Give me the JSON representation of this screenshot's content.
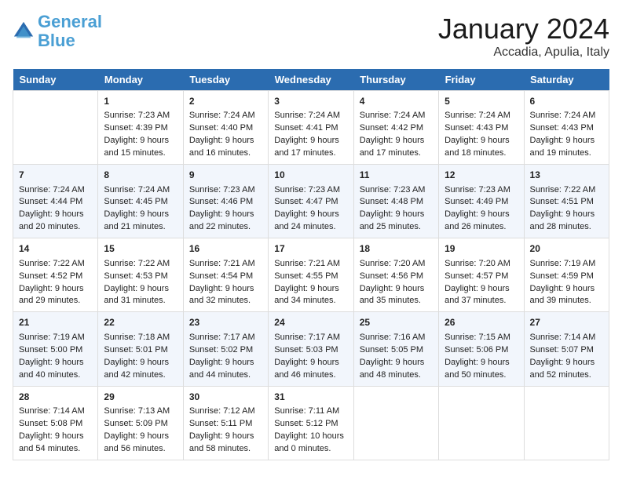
{
  "header": {
    "logo_line1": "General",
    "logo_line2": "Blue",
    "month": "January 2024",
    "location": "Accadia, Apulia, Italy"
  },
  "weekdays": [
    "Sunday",
    "Monday",
    "Tuesday",
    "Wednesday",
    "Thursday",
    "Friday",
    "Saturday"
  ],
  "weeks": [
    [
      {
        "day": "",
        "info": ""
      },
      {
        "day": "1",
        "info": "Sunrise: 7:23 AM\nSunset: 4:39 PM\nDaylight: 9 hours\nand 15 minutes."
      },
      {
        "day": "2",
        "info": "Sunrise: 7:24 AM\nSunset: 4:40 PM\nDaylight: 9 hours\nand 16 minutes."
      },
      {
        "day": "3",
        "info": "Sunrise: 7:24 AM\nSunset: 4:41 PM\nDaylight: 9 hours\nand 17 minutes."
      },
      {
        "day": "4",
        "info": "Sunrise: 7:24 AM\nSunset: 4:42 PM\nDaylight: 9 hours\nand 17 minutes."
      },
      {
        "day": "5",
        "info": "Sunrise: 7:24 AM\nSunset: 4:43 PM\nDaylight: 9 hours\nand 18 minutes."
      },
      {
        "day": "6",
        "info": "Sunrise: 7:24 AM\nSunset: 4:43 PM\nDaylight: 9 hours\nand 19 minutes."
      }
    ],
    [
      {
        "day": "7",
        "info": "Sunrise: 7:24 AM\nSunset: 4:44 PM\nDaylight: 9 hours\nand 20 minutes."
      },
      {
        "day": "8",
        "info": "Sunrise: 7:24 AM\nSunset: 4:45 PM\nDaylight: 9 hours\nand 21 minutes."
      },
      {
        "day": "9",
        "info": "Sunrise: 7:23 AM\nSunset: 4:46 PM\nDaylight: 9 hours\nand 22 minutes."
      },
      {
        "day": "10",
        "info": "Sunrise: 7:23 AM\nSunset: 4:47 PM\nDaylight: 9 hours\nand 24 minutes."
      },
      {
        "day": "11",
        "info": "Sunrise: 7:23 AM\nSunset: 4:48 PM\nDaylight: 9 hours\nand 25 minutes."
      },
      {
        "day": "12",
        "info": "Sunrise: 7:23 AM\nSunset: 4:49 PM\nDaylight: 9 hours\nand 26 minutes."
      },
      {
        "day": "13",
        "info": "Sunrise: 7:22 AM\nSunset: 4:51 PM\nDaylight: 9 hours\nand 28 minutes."
      }
    ],
    [
      {
        "day": "14",
        "info": "Sunrise: 7:22 AM\nSunset: 4:52 PM\nDaylight: 9 hours\nand 29 minutes."
      },
      {
        "day": "15",
        "info": "Sunrise: 7:22 AM\nSunset: 4:53 PM\nDaylight: 9 hours\nand 31 minutes."
      },
      {
        "day": "16",
        "info": "Sunrise: 7:21 AM\nSunset: 4:54 PM\nDaylight: 9 hours\nand 32 minutes."
      },
      {
        "day": "17",
        "info": "Sunrise: 7:21 AM\nSunset: 4:55 PM\nDaylight: 9 hours\nand 34 minutes."
      },
      {
        "day": "18",
        "info": "Sunrise: 7:20 AM\nSunset: 4:56 PM\nDaylight: 9 hours\nand 35 minutes."
      },
      {
        "day": "19",
        "info": "Sunrise: 7:20 AM\nSunset: 4:57 PM\nDaylight: 9 hours\nand 37 minutes."
      },
      {
        "day": "20",
        "info": "Sunrise: 7:19 AM\nSunset: 4:59 PM\nDaylight: 9 hours\nand 39 minutes."
      }
    ],
    [
      {
        "day": "21",
        "info": "Sunrise: 7:19 AM\nSunset: 5:00 PM\nDaylight: 9 hours\nand 40 minutes."
      },
      {
        "day": "22",
        "info": "Sunrise: 7:18 AM\nSunset: 5:01 PM\nDaylight: 9 hours\nand 42 minutes."
      },
      {
        "day": "23",
        "info": "Sunrise: 7:17 AM\nSunset: 5:02 PM\nDaylight: 9 hours\nand 44 minutes."
      },
      {
        "day": "24",
        "info": "Sunrise: 7:17 AM\nSunset: 5:03 PM\nDaylight: 9 hours\nand 46 minutes."
      },
      {
        "day": "25",
        "info": "Sunrise: 7:16 AM\nSunset: 5:05 PM\nDaylight: 9 hours\nand 48 minutes."
      },
      {
        "day": "26",
        "info": "Sunrise: 7:15 AM\nSunset: 5:06 PM\nDaylight: 9 hours\nand 50 minutes."
      },
      {
        "day": "27",
        "info": "Sunrise: 7:14 AM\nSunset: 5:07 PM\nDaylight: 9 hours\nand 52 minutes."
      }
    ],
    [
      {
        "day": "28",
        "info": "Sunrise: 7:14 AM\nSunset: 5:08 PM\nDaylight: 9 hours\nand 54 minutes."
      },
      {
        "day": "29",
        "info": "Sunrise: 7:13 AM\nSunset: 5:09 PM\nDaylight: 9 hours\nand 56 minutes."
      },
      {
        "day": "30",
        "info": "Sunrise: 7:12 AM\nSunset: 5:11 PM\nDaylight: 9 hours\nand 58 minutes."
      },
      {
        "day": "31",
        "info": "Sunrise: 7:11 AM\nSunset: 5:12 PM\nDaylight: 10 hours\nand 0 minutes."
      },
      {
        "day": "",
        "info": ""
      },
      {
        "day": "",
        "info": ""
      },
      {
        "day": "",
        "info": ""
      }
    ]
  ]
}
